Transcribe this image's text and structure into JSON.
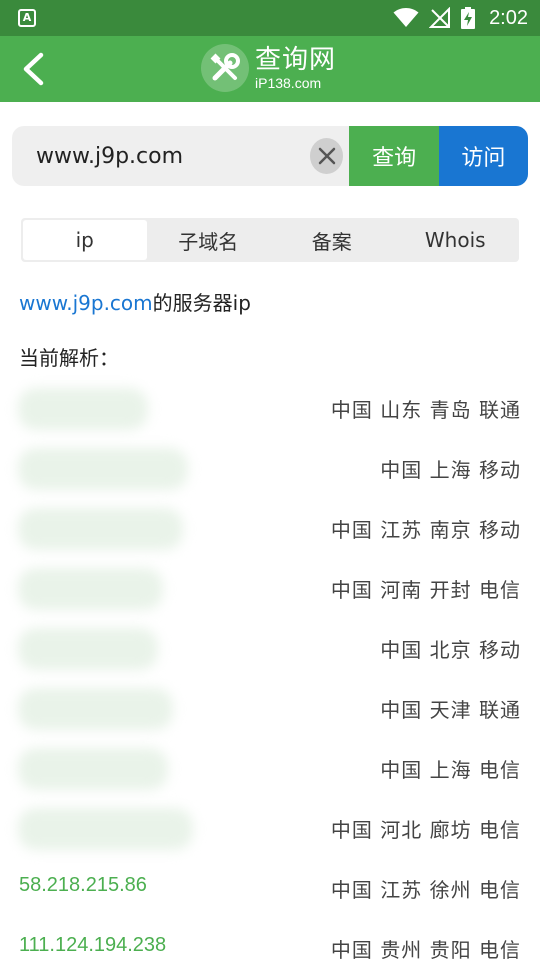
{
  "status_bar": {
    "app_icon_letter": "A",
    "time": "2:02"
  },
  "app_bar": {
    "logo_title": "查询网",
    "logo_subtitle": "iP138.com"
  },
  "search": {
    "value": "www.j9p.com",
    "query_label": "查询",
    "visit_label": "访问"
  },
  "tabs": [
    {
      "label": "ip",
      "active": true
    },
    {
      "label": "子域名",
      "active": false
    },
    {
      "label": "备案",
      "active": false
    },
    {
      "label": "Whois",
      "active": false
    }
  ],
  "content": {
    "domain": "www.j9p.com",
    "server_ip_suffix": "的服务器ip",
    "current_label": "当前解析："
  },
  "records": [
    {
      "ip": "",
      "blurred": true,
      "blur_width": 130,
      "location": "中国 山东 青岛 联通"
    },
    {
      "ip": "",
      "blurred": true,
      "blur_width": 170,
      "location": "中国 上海 移动"
    },
    {
      "ip": "",
      "blurred": true,
      "blur_width": 165,
      "location": "中国 江苏 南京 移动"
    },
    {
      "ip": "",
      "blurred": true,
      "blur_width": 145,
      "location": "中国 河南 开封 电信"
    },
    {
      "ip": "",
      "blurred": true,
      "blur_width": 140,
      "location": "中国 北京 移动"
    },
    {
      "ip": "",
      "blurred": true,
      "blur_width": 155,
      "location": "中国 天津 联通"
    },
    {
      "ip": "",
      "blurred": true,
      "blur_width": 150,
      "location": "中国 上海 电信"
    },
    {
      "ip": "",
      "blurred": true,
      "blur_width": 175,
      "location": "中国 河北 廊坊 电信"
    },
    {
      "ip": "58.218.215.86",
      "blurred": false,
      "location": "中国 江苏 徐州 电信"
    },
    {
      "ip": "111.124.194.238",
      "blurred": false,
      "location": "中国 贵州 贵阳 电信"
    }
  ]
}
